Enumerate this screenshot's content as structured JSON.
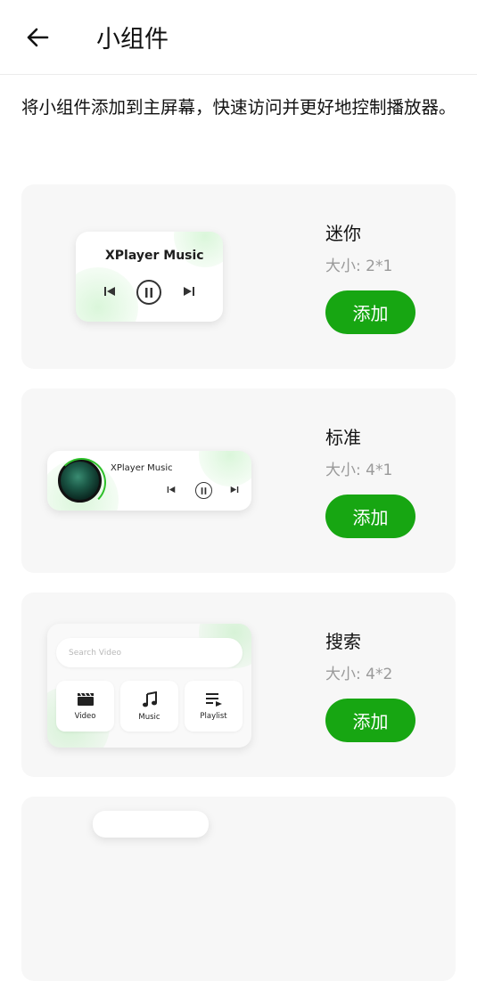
{
  "header": {
    "title": "小组件",
    "back_icon": "arrow-left-icon"
  },
  "intro": "将小组件添加到主屏幕，快速访问并更好地控制播放器。",
  "colors": {
    "accent": "#17a612",
    "card_bg": "#f7f7f7",
    "muted": "#9a9a9a"
  },
  "widgets": [
    {
      "name": "迷你",
      "size": "大小: 2*1",
      "button": "添加",
      "preview": {
        "title": "XPlayer Music"
      }
    },
    {
      "name": "标准",
      "size": "大小: 4*1",
      "button": "添加",
      "preview": {
        "title": "XPlayer Music"
      }
    },
    {
      "name": "搜索",
      "size": "大小: 4*2",
      "button": "添加",
      "preview": {
        "search_placeholder": "Search Video",
        "tiles": [
          {
            "label": "Video",
            "icon": "clapperboard-icon"
          },
          {
            "label": "Music",
            "icon": "music-note-icon"
          },
          {
            "label": "Playlist",
            "icon": "playlist-icon"
          }
        ]
      }
    }
  ]
}
